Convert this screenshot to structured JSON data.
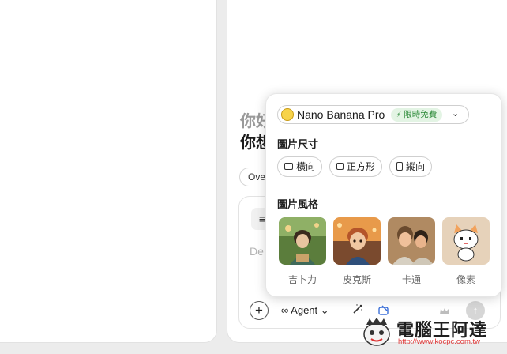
{
  "greeting": {
    "line1": "你好",
    "line2": "你想"
  },
  "chip": {
    "label": "Ove"
  },
  "composer": {
    "placeholder": "De",
    "tool_glyph": "≡",
    "add_glyph": "+",
    "agent_label": "∞ Agent ⌄",
    "send_glyph": "↑"
  },
  "model": {
    "name": "Nano Banana Pro",
    "badge": "限時免費",
    "banana_glyph": "🍌",
    "chevron": "⌄",
    "bolt": "⚡"
  },
  "size_section": {
    "title": "圖片尺寸",
    "options": [
      {
        "label": "橫向",
        "icon": "landscape-icon"
      },
      {
        "label": "正方形",
        "icon": "square-icon"
      },
      {
        "label": "縱向",
        "icon": "portrait-icon"
      }
    ]
  },
  "style_section": {
    "title": "圖片風格",
    "styles": [
      {
        "label": "吉卜力"
      },
      {
        "label": "皮克斯"
      },
      {
        "label": "卡通"
      },
      {
        "label": "像素"
      }
    ]
  },
  "watermark": {
    "title": "電腦王阿達",
    "url": "http://www.kocpc.com.tw"
  },
  "colors": {
    "badge_bg": "#e3f4e4",
    "badge_text": "#2e8b3a",
    "accent_blue": "#3b6fd9"
  }
}
